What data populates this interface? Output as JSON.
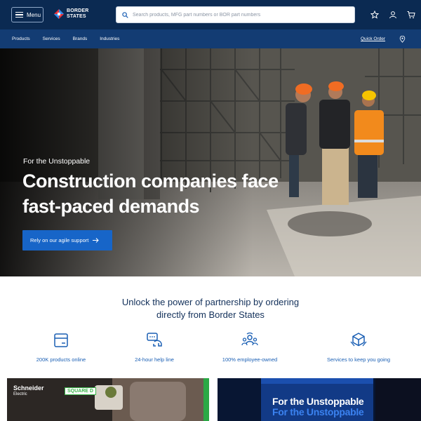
{
  "header": {
    "menu_label": "Menu",
    "logo_text": "BORDER\nSTATES",
    "search_placeholder": "Search products, MFG part numbers or BOR part numbers",
    "icons": [
      "star-icon",
      "user-icon",
      "cart-icon"
    ]
  },
  "nav": {
    "items": [
      "Products",
      "Services",
      "Brands",
      "Industries"
    ],
    "quick_order": "Quick Order",
    "location_icon": "location-pin-icon"
  },
  "hero": {
    "eyebrow": "For the Unstoppable",
    "title": "Construction companies face fast-paced demands",
    "cta": "Rely on our agile support"
  },
  "partnership": {
    "heading_line1": "Unlock the power of partnership by ordering",
    "heading_line2": "directly from Border States",
    "features": [
      {
        "icon": "box-icon",
        "label": "200K products online"
      },
      {
        "icon": "chat-support-icon",
        "label": "24-hour help line"
      },
      {
        "icon": "team-icon",
        "label": "100% employee-owned"
      },
      {
        "icon": "service-cube-icon",
        "label": "Services to keep you going"
      }
    ]
  },
  "cards": {
    "left": {
      "brand": "Schneider",
      "brand_sub": "Electric",
      "badge": "SQUARE D"
    },
    "right": {
      "line1": "For the Unstoppable",
      "line2": "For the Unstoppable"
    }
  },
  "colors": {
    "header_bg": "#0b2a52",
    "nav_bg": "#133c73",
    "accent": "#1765c8",
    "heading": "#12305a"
  }
}
